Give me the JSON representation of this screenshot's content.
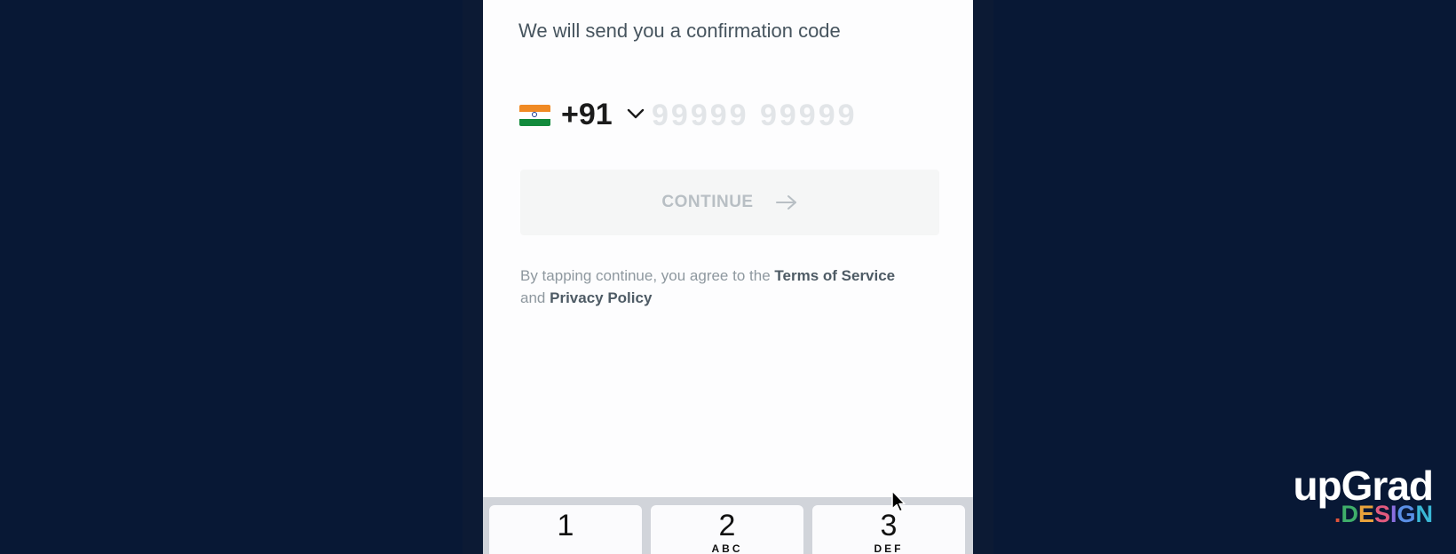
{
  "signin": {
    "subtitle": "We will send you a confirmation code",
    "country_code": "+91",
    "country_flag": "india-flag-icon",
    "phone_value": "",
    "phone_placeholder": "99999 99999",
    "continue_label": "CONTINUE",
    "legal_prefix": "By tapping continue, you agree to the",
    "terms_link": "Terms of Service",
    "legal_and": "and",
    "privacy_link": "Privacy Policy"
  },
  "keyboard": {
    "keys": [
      {
        "number": "1",
        "letters": ""
      },
      {
        "number": "2",
        "letters": "ABC"
      },
      {
        "number": "3",
        "letters": "DEF"
      }
    ]
  },
  "branding": {
    "logo_main": "upGrad",
    "logo_sub": ".DESIGN"
  },
  "colors": {
    "background": "#081835",
    "button_disabled": "#f5f6f6",
    "text_link": "#4e5b65"
  }
}
